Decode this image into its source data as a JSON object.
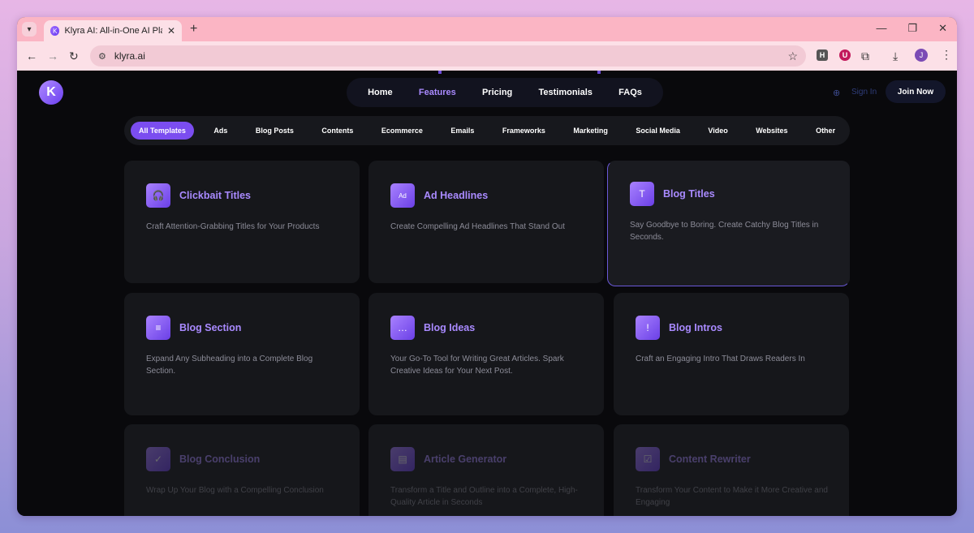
{
  "browser": {
    "tab_title": "Klyra AI: All-in-One AI Platform",
    "url": "klyra.ai",
    "profile_initial": "J",
    "extensions": [
      "H",
      "U"
    ]
  },
  "nav": {
    "items": [
      {
        "label": "Home",
        "active": false
      },
      {
        "label": "Features",
        "active": true
      },
      {
        "label": "Pricing",
        "active": false
      },
      {
        "label": "Testimonials",
        "active": false
      },
      {
        "label": "FAQs",
        "active": false
      }
    ],
    "sign_in": "Sign In",
    "join": "Join Now"
  },
  "filters": [
    {
      "label": "All Templates",
      "active": true
    },
    {
      "label": "Ads"
    },
    {
      "label": "Blog Posts"
    },
    {
      "label": "Contents"
    },
    {
      "label": "Ecommerce"
    },
    {
      "label": "Emails"
    },
    {
      "label": "Frameworks"
    },
    {
      "label": "Marketing"
    },
    {
      "label": "Social Media"
    },
    {
      "label": "Video"
    },
    {
      "label": "Websites"
    },
    {
      "label": "Other"
    }
  ],
  "cards": [
    {
      "title": "Clickbait Titles",
      "desc": "Craft Attention-Grabbing Titles for Your Products",
      "icon": "headset-icon",
      "glyph": "🎧"
    },
    {
      "title": "Ad Headlines",
      "desc": "Create Compelling Ad Headlines That Stand Out",
      "icon": "ad-icon",
      "glyph": "Ad"
    },
    {
      "title": "Blog Titles",
      "desc": "Say Goodbye to Boring. Create Catchy Blog Titles in Seconds.",
      "icon": "text-bubble-icon",
      "glyph": "T",
      "hovered": true
    },
    {
      "title": "Blog Section",
      "desc": "Expand Any Subheading into a Complete Blog Section.",
      "icon": "comment-icon",
      "glyph": "≡"
    },
    {
      "title": "Blog Ideas",
      "desc": "Your Go-To Tool for Writing Great Articles. Spark Creative Ideas for Your Next Post.",
      "icon": "chat-dots-icon",
      "glyph": "…"
    },
    {
      "title": "Blog Intros",
      "desc": "Craft an Engaging Intro That Draws Readers In",
      "icon": "alert-bubble-icon",
      "glyph": "!"
    },
    {
      "title": "Blog Conclusion",
      "desc": "Wrap Up Your Blog with a Compelling Conclusion",
      "icon": "comment-check-icon",
      "glyph": "✓",
      "faded": true
    },
    {
      "title": "Article Generator",
      "desc": "Transform a Title and Outline into a Complete, High-Quality Article in Seconds",
      "icon": "document-icon",
      "glyph": "▤",
      "faded": true
    },
    {
      "title": "Content Rewriter",
      "desc": "Transform Your Content to Make it More Creative and Engaging",
      "icon": "checkbox-icon",
      "glyph": "☑",
      "faded": true
    }
  ]
}
